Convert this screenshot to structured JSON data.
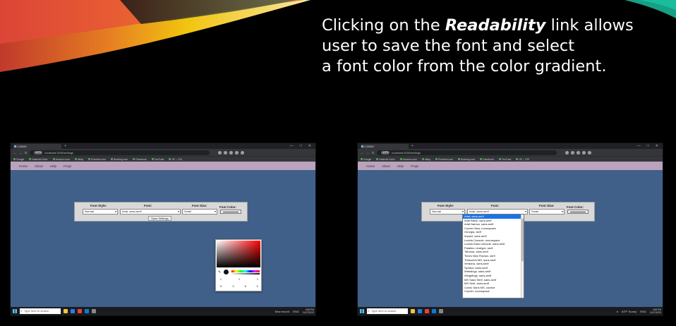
{
  "caption": {
    "prefix": "Clicking on the ",
    "emphasis": "Readability",
    "line1_suffix": " link allows",
    "line2": "user to save the font and select",
    "line3": "a font color from the color gradient."
  },
  "browser": {
    "tab_title": "CJSMH",
    "tab_new": "+",
    "window_controls": [
      "—",
      "□",
      "✕"
    ],
    "url": "localhost:3000/settings",
    "url_badge": "sVFk",
    "bookmarks": [
      "Google",
      "Ndstrubi Scrbr",
      "Amazon.com",
      "eBay",
      "Priceline.com",
      "Booking.com",
      "Facebook",
      "YouTube",
      "UF – CIS"
    ]
  },
  "site_nav": [
    "Home",
    "About",
    "Help",
    "FAQs"
  ],
  "settings_panel": {
    "font_style_label": "Font Style:",
    "font_label": "Font:",
    "font_size_label": "Font Size:",
    "font_color_label": "Font Color:",
    "font_style_value": "Normal",
    "font_value": "Arial, sans-serif",
    "font_size_value": "Small",
    "save_button": "Save Settings"
  },
  "color_picker": {
    "channel_values": [
      "0",
      "0",
      "0"
    ],
    "channel_labels": [
      "R",
      "G",
      "B",
      "A"
    ],
    "selected_color": "#000000"
  },
  "font_dropdown": {
    "options": [
      "Arial, sans-serif",
      "Arial Black, sans-serif",
      "Arial Narrow, sans-serif",
      "Courier New, monospace",
      "Georgia, serif",
      "Impact, sans-serif",
      "Lucida Console, monospace",
      "Lucida Sans Unicode, sans-serif",
      "Palatino Linotype, serif",
      "Tahoma, sans-serif",
      "Times New Roman, serif",
      "Trebuchet MS, sans-serif",
      "Verdana, sans-serif",
      "Symbol, sans-serif",
      "Webdings, sans-serif",
      "Wingdings, sans-serif",
      "MS Sans Serif, sans-serif",
      "MS Serif, sans-serif",
      "Comic Sans MS, cursive",
      "Courier, monospace"
    ],
    "selected_index": 0
  },
  "taskbar_left": {
    "search_placeholder": "Type here to search",
    "tray_text": "New record",
    "lang": "ENG",
    "time": "4:55 PM",
    "date": "11/27/2023"
  },
  "taskbar_right": {
    "search_placeholder": "Type here to search",
    "tray_text": "63°F Sunny",
    "lang": "ENG",
    "time": "4:55 PM",
    "date": "11/27/2023"
  }
}
